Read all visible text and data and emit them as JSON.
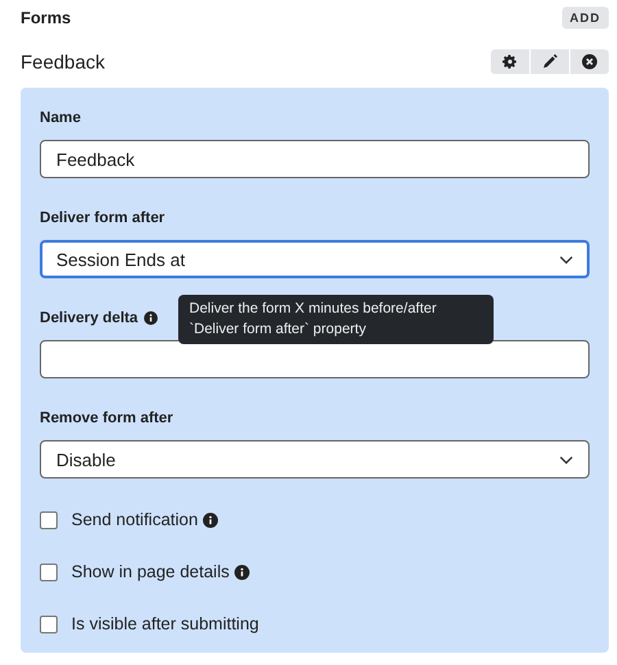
{
  "header": {
    "title": "Forms",
    "add_button": "ADD"
  },
  "form": {
    "name": "Feedback"
  },
  "fields": [
    {
      "kind": "text",
      "label": "Name",
      "value": "Feedback",
      "focused": false,
      "info": false
    },
    {
      "kind": "select",
      "label": "Deliver form after",
      "value": "Session Ends at",
      "focused": true,
      "info": false
    },
    {
      "kind": "text",
      "label": "Delivery delta",
      "focused": false,
      "info": true,
      "tooltip": "Deliver the form X minutes before/after `Deliver form after` property"
    },
    {
      "kind": "select",
      "label": "Remove form after",
      "value": "Disable",
      "focused": false,
      "info": false
    },
    {
      "kind": "checkbox",
      "label": "Send notification",
      "checked": false,
      "info": true
    },
    {
      "kind": "checkbox",
      "label": "Show in page details",
      "checked": false,
      "info": true
    },
    {
      "kind": "checkbox",
      "label": "Is visible after submitting",
      "checked": false,
      "info": false
    }
  ]
}
